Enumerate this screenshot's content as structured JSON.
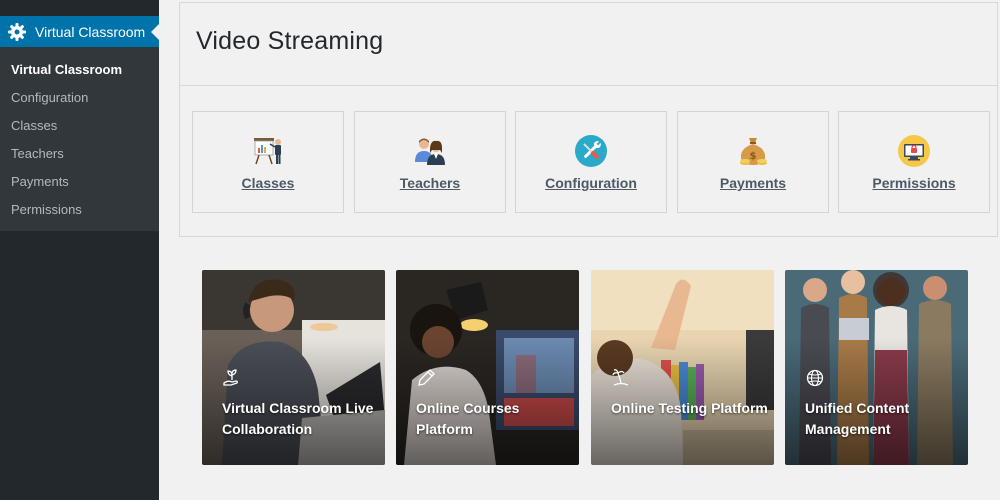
{
  "sidebar": {
    "header_title": "Virtual Classroom",
    "items": [
      {
        "label": "Virtual Classroom",
        "active": true
      },
      {
        "label": "Configuration"
      },
      {
        "label": "Classes"
      },
      {
        "label": "Teachers"
      },
      {
        "label": "Payments"
      },
      {
        "label": "Permissions"
      }
    ]
  },
  "page": {
    "title": "Video Streaming"
  },
  "cards": [
    {
      "label": "Classes",
      "icon": "presentation-icon"
    },
    {
      "label": "Teachers",
      "icon": "teachers-icon"
    },
    {
      "label": "Configuration",
      "icon": "tools-icon"
    },
    {
      "label": "Payments",
      "icon": "money-bag-icon"
    },
    {
      "label": "Permissions",
      "icon": "permissions-icon"
    }
  ],
  "features": [
    {
      "label": "Virtual Classroom Live Collaboration",
      "icon": "hand-plant-icon"
    },
    {
      "label": "Online Courses Platform",
      "icon": "pen-icon"
    },
    {
      "label": "Online Testing Platform",
      "icon": "island-icon"
    },
    {
      "label": "Unified Content Management",
      "icon": "globe-icon"
    }
  ],
  "colors": {
    "sidebar_bg": "#23282d",
    "submenu_bg": "#32373c",
    "accent": "#0073aa"
  }
}
